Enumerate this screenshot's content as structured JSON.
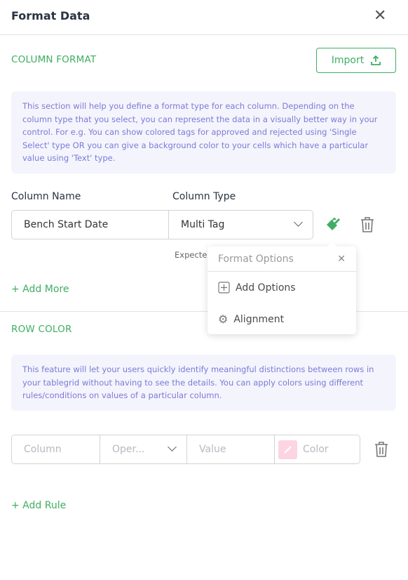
{
  "header": {
    "title": "Format Data",
    "close_icon": "close-icon"
  },
  "column_format": {
    "title": "COLUMN FORMAT",
    "import_label": "Import",
    "info": "This section will help you define a format type for each column. Depending on the column type that you select, you can represent the data in a visually better way in your control. For e.g. You can show colored tags for approved and rejected using 'Single Select' type OR you can give a background color to your cells which have a particular value using 'Text' type.",
    "column_name_label": "Column Name",
    "column_type_label": "Column Type",
    "column_name_value": "Bench Start Date",
    "column_type_value": "Multi Tag",
    "expected_text": "Expecte",
    "add_more": "+ Add More"
  },
  "format_options": {
    "title": "Format Options",
    "items": [
      {
        "label": "Add Options",
        "icon": "plus-square-icon"
      },
      {
        "label": "Alignment",
        "icon": "gear-icon"
      }
    ]
  },
  "row_color": {
    "title": "ROW COLOR",
    "info": "This feature will let your users quickly identify meaningful distinctions between rows in your tablegrid without having to see the details. You can apply colors using different rules/conditions on values of a particular column.",
    "column_placeholder": "Column",
    "operator_placeholder": "Oper...",
    "value_placeholder": "Value",
    "color_placeholder": "Color",
    "swatch_color": "#fdd5e2",
    "add_rule": "+ Add Rule"
  },
  "colors": {
    "accent": "#3fae62",
    "info_text": "#7b7bd6",
    "info_bg": "#f4f4fd"
  }
}
